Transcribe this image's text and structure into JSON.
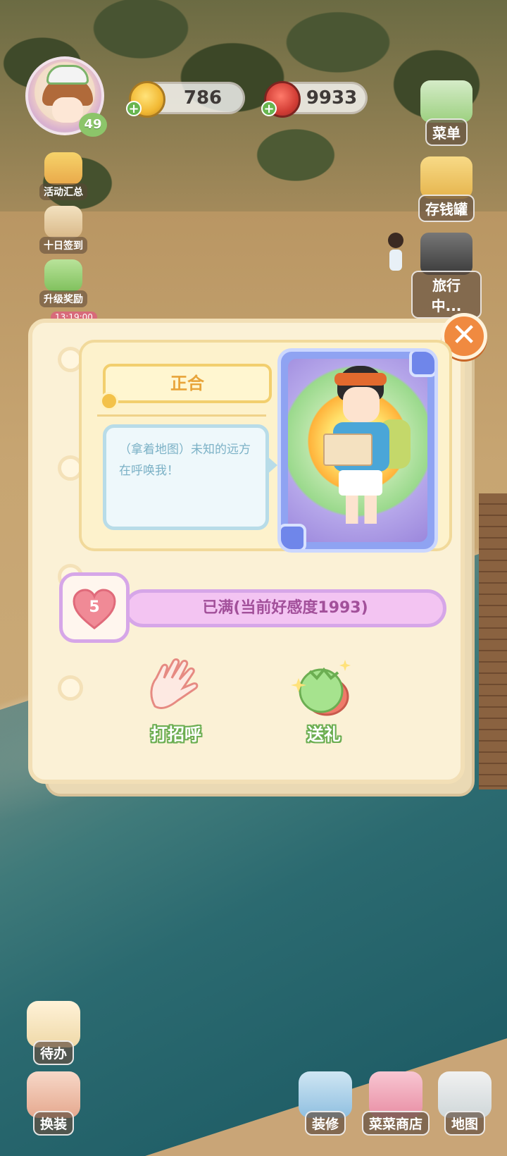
{
  "hud": {
    "level": "49",
    "coins": "786",
    "meat": "9933"
  },
  "left_buttons": [
    {
      "label": "活动汇总",
      "icon": "event-summary-icon"
    },
    {
      "label": "十日签到",
      "icon": "ten-day-checkin-icon"
    },
    {
      "label": "升级奖励",
      "icon": "levelup-reward-icon"
    }
  ],
  "timer": "13:19:00",
  "right_buttons": [
    {
      "label": "菜单",
      "icon": "menu-icon"
    },
    {
      "label": "存钱罐",
      "icon": "piggy-bank-icon"
    },
    {
      "label": "旅行中...",
      "icon": "camera-icon"
    }
  ],
  "dialog": {
    "close_label": "✕",
    "character_name": "正合",
    "speech": "（拿着地图）未知的远方在呼唤我！",
    "favor_level": "5",
    "favor_status": "已满(当前好感度1993)",
    "actions": [
      {
        "label": "打招呼",
        "icon": "wave-hand-icon"
      },
      {
        "label": "送礼",
        "icon": "gift-icon"
      }
    ]
  },
  "bottom_left": [
    {
      "label": "待办",
      "icon": "todo-icon"
    },
    {
      "label": "换装",
      "icon": "dress-up-icon"
    }
  ],
  "bottom_right": [
    {
      "label": "装修",
      "icon": "decorate-icon"
    },
    {
      "label": "菜菜商店",
      "icon": "shop-icon"
    },
    {
      "label": "地图",
      "icon": "map-icon"
    }
  ],
  "colors": {
    "accent_orange": "#f08a40",
    "favor_pink": "#f3c4f2",
    "action_green": "#6cae52",
    "name_gold": "#e8a43a"
  }
}
